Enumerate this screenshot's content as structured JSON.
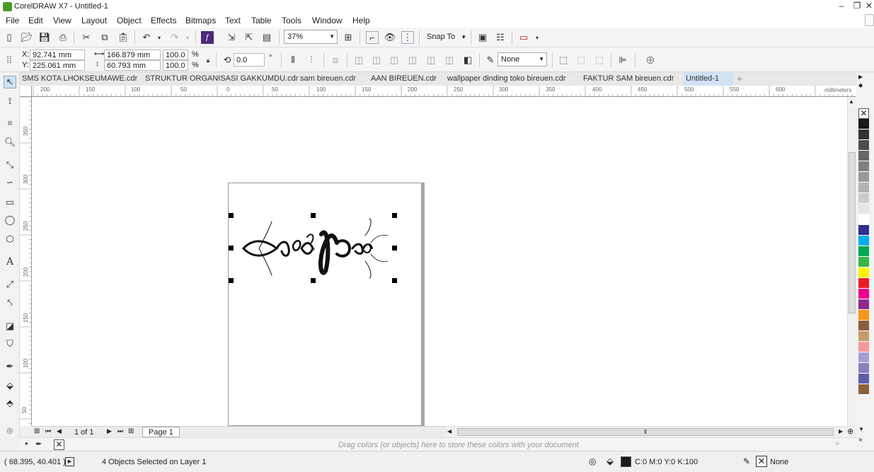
{
  "window": {
    "title": "CorelDRAW X7 - Untitled-1",
    "minimize_icon": "minimize-icon",
    "restore_icon": "restore-icon",
    "close_icon": "close-icon"
  },
  "menu": [
    "File",
    "Edit",
    "View",
    "Layout",
    "Object",
    "Effects",
    "Bitmaps",
    "Text",
    "Table",
    "Tools",
    "Window",
    "Help"
  ],
  "standard_toolbar": {
    "zoom_value": "37%",
    "snap_to_label": "Snap To"
  },
  "property_bar": {
    "x_label": "X:",
    "x_value": "92.741 mm",
    "y_label": "Y:",
    "y_value": "225.061 mm",
    "width_value": "166.879 mm",
    "height_value": "60.793 mm",
    "scale_x": "100.0",
    "scale_y": "100.0",
    "percent": "%",
    "rotation_value": "0.0",
    "degree": "°",
    "outline_width": "None"
  },
  "doc_tabs": [
    "SMS KOTA LHOKSEUMAWE.cdr",
    "STRUKTUR ORGANISASI GAKKUMDU.cdr",
    "sam bireuen.cdr",
    "AAN BIREUEN.cdr",
    "wallpaper dinding toko bireuen.cdr",
    "FAKTUR SAM bireuen.cdr",
    "Untitled-1"
  ],
  "active_tab_index": 6,
  "ruler": {
    "h_ticks": [
      "200",
      "150",
      "100",
      "50",
      "0",
      "50",
      "100",
      "150",
      "200",
      "250",
      "300",
      "350",
      "400",
      "450",
      "500",
      "550",
      "600"
    ],
    "h_unit": "millimeters",
    "v_ticks": [
      "350",
      "300",
      "250",
      "200",
      "150",
      "100",
      "50"
    ],
    "v_unit": "millimeters"
  },
  "page_nav": {
    "page_count": "1 of 1",
    "page_tab": "Page 1"
  },
  "doc_palette_hint": "Drag colors (or objects) here to store these colors with your document",
  "palette_colors": [
    "#1a1a1a",
    "#333333",
    "#4d4d4d",
    "#666666",
    "#808080",
    "#999999",
    "#b3b3b3",
    "#cccccc",
    "#e6e6e6",
    "#ffffff",
    "#2e3192",
    "#00aeef",
    "#00a651",
    "#39b54a",
    "#fff200",
    "#ed1c24",
    "#ec008c",
    "#92278f",
    "#f7941d",
    "#8b5e3c",
    "#c69c6d",
    "#f5989d",
    "#a3a0d1",
    "#8781bd",
    "#605ca8",
    "#8c6239"
  ],
  "status": {
    "coords": "( 68.395, 40.401 )",
    "selection": "4 Objects Selected on Layer 1",
    "fill_color": "C:0 M:0 Y:0 K:100",
    "outline": "None"
  }
}
